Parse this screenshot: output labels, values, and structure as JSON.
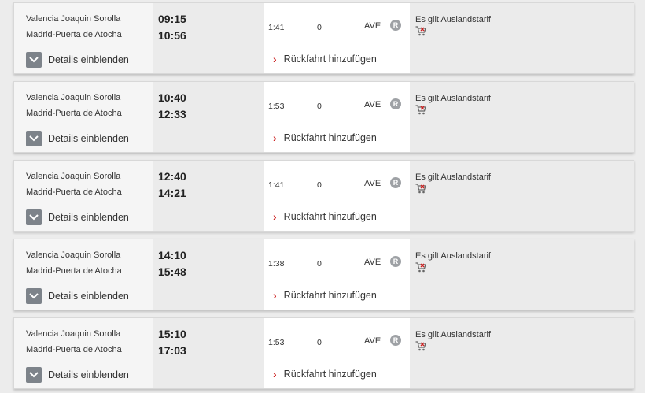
{
  "connections": [
    {
      "from": "Valencia Joaquin Sorolla",
      "to": "Madrid-Puerta de Atocha",
      "dep": "09:15",
      "arr": "10:56",
      "duration": "1:41",
      "changes": "0",
      "train": "AVE",
      "badge": "R",
      "tariff": "Es gilt Auslandstarif",
      "details_label": "Details einblenden",
      "return_label": "Rückfahrt hinzufügen"
    },
    {
      "from": "Valencia Joaquin Sorolla",
      "to": "Madrid-Puerta de Atocha",
      "dep": "10:40",
      "arr": "12:33",
      "duration": "1:53",
      "changes": "0",
      "train": "AVE",
      "badge": "R",
      "tariff": "Es gilt Auslandstarif",
      "details_label": "Details einblenden",
      "return_label": "Rückfahrt hinzufügen"
    },
    {
      "from": "Valencia Joaquin Sorolla",
      "to": "Madrid-Puerta de Atocha",
      "dep": "12:40",
      "arr": "14:21",
      "duration": "1:41",
      "changes": "0",
      "train": "AVE",
      "badge": "R",
      "tariff": "Es gilt Auslandstarif",
      "details_label": "Details einblenden",
      "return_label": "Rückfahrt hinzufügen"
    },
    {
      "from": "Valencia Joaquin Sorolla",
      "to": "Madrid-Puerta de Atocha",
      "dep": "14:10",
      "arr": "15:48",
      "duration": "1:38",
      "changes": "0",
      "train": "AVE",
      "badge": "R",
      "tariff": "Es gilt Auslandstarif",
      "details_label": "Details einblenden",
      "return_label": "Rückfahrt hinzufügen"
    },
    {
      "from": "Valencia Joaquin Sorolla",
      "to": "Madrid-Puerta de Atocha",
      "dep": "15:10",
      "arr": "17:03",
      "duration": "1:53",
      "changes": "0",
      "train": "AVE",
      "badge": "R",
      "tariff": "Es gilt Auslandstarif",
      "details_label": "Details einblenden",
      "return_label": "Rückfahrt hinzufügen"
    }
  ],
  "icons": {
    "details": "chevron-down-icon",
    "return": "chevron-right-icon",
    "badge": "reservation-badge",
    "cart": "shopping-cart-icon"
  },
  "colors": {
    "accent_red": "#cc1f1f",
    "badge_gray": "#9ea1a5",
    "button_gray": "#7d838a"
  }
}
